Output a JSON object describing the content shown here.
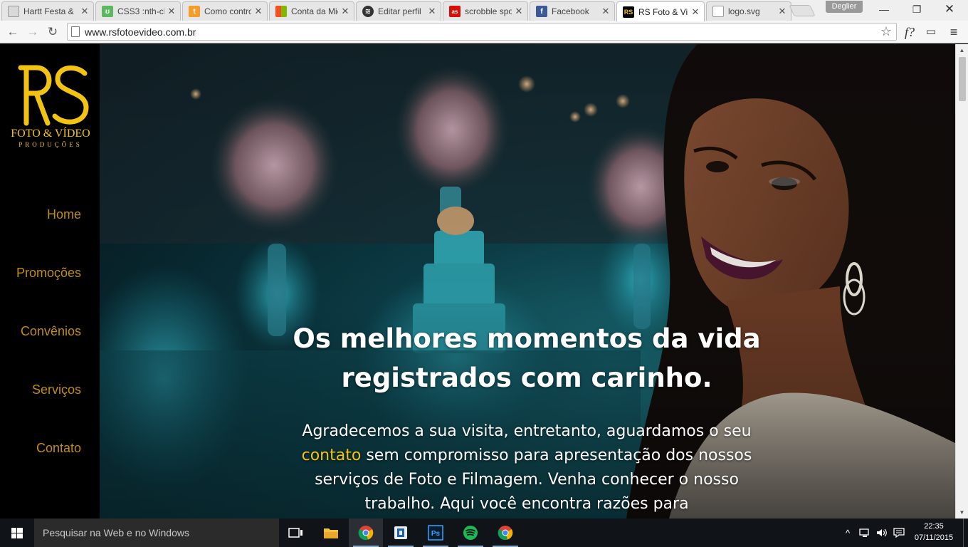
{
  "browser": {
    "tabs": [
      {
        "title": "Hartt Festa &",
        "icon": "page-icon",
        "color": "#d9d9d9"
      },
      {
        "title": "CSS3 :nth-ch",
        "icon": "caniuse-icon",
        "color": "#5cb85c"
      },
      {
        "title": "Como contro",
        "icon": "taringa-icon",
        "color": "#f59d2a"
      },
      {
        "title": "Conta da Mic",
        "icon": "microsoft-icon",
        "color": "#00a4ef"
      },
      {
        "title": "Editar perfil",
        "icon": "spotify-icon",
        "color": "#333333"
      },
      {
        "title": "scrobble spo",
        "icon": "lastfm-icon",
        "color": "#d51007"
      },
      {
        "title": "Facebook",
        "icon": "facebook-icon",
        "color": "#3b5998"
      },
      {
        "title": "RS Foto & Vi",
        "icon": "rs-logo-icon",
        "color": "#000000",
        "active": true
      },
      {
        "title": "logo.svg",
        "icon": "page-icon",
        "color": "#d9d9d9"
      }
    ],
    "profile_name": "Deglier",
    "url": "www.rsfotoevideo.com.br"
  },
  "site": {
    "brand": {
      "title": "FOTO & VÍDEO",
      "subtitle": "PRODUÇÕES",
      "color": "#f3c313"
    },
    "nav": [
      "Home",
      "Promoções",
      "Convênios",
      "Serviços",
      "Contato"
    ],
    "nav_color": "#c08d12",
    "hero": {
      "title_line1": "Os melhores momentos da vida",
      "title_line2": "registrados com carinho.",
      "text_before": "Agradecemos a sua visita, entretanto, aguardamos o seu ",
      "text_link": "contato",
      "text_after": " sem compromisso para apresentação dos nossos serviços de Foto e Filmagem. Venha conhecer o nosso trabalho. Aqui você encontra razões para"
    }
  },
  "taskbar": {
    "search_placeholder": "Pesquisar na Web e no Windows",
    "time": "22:35",
    "date": "07/11/2015",
    "apps": [
      "task-view-icon",
      "file-explorer-icon",
      "chrome-icon",
      "app-icon",
      "photoshop-icon",
      "spotify-icon",
      "chrome-icon"
    ]
  }
}
